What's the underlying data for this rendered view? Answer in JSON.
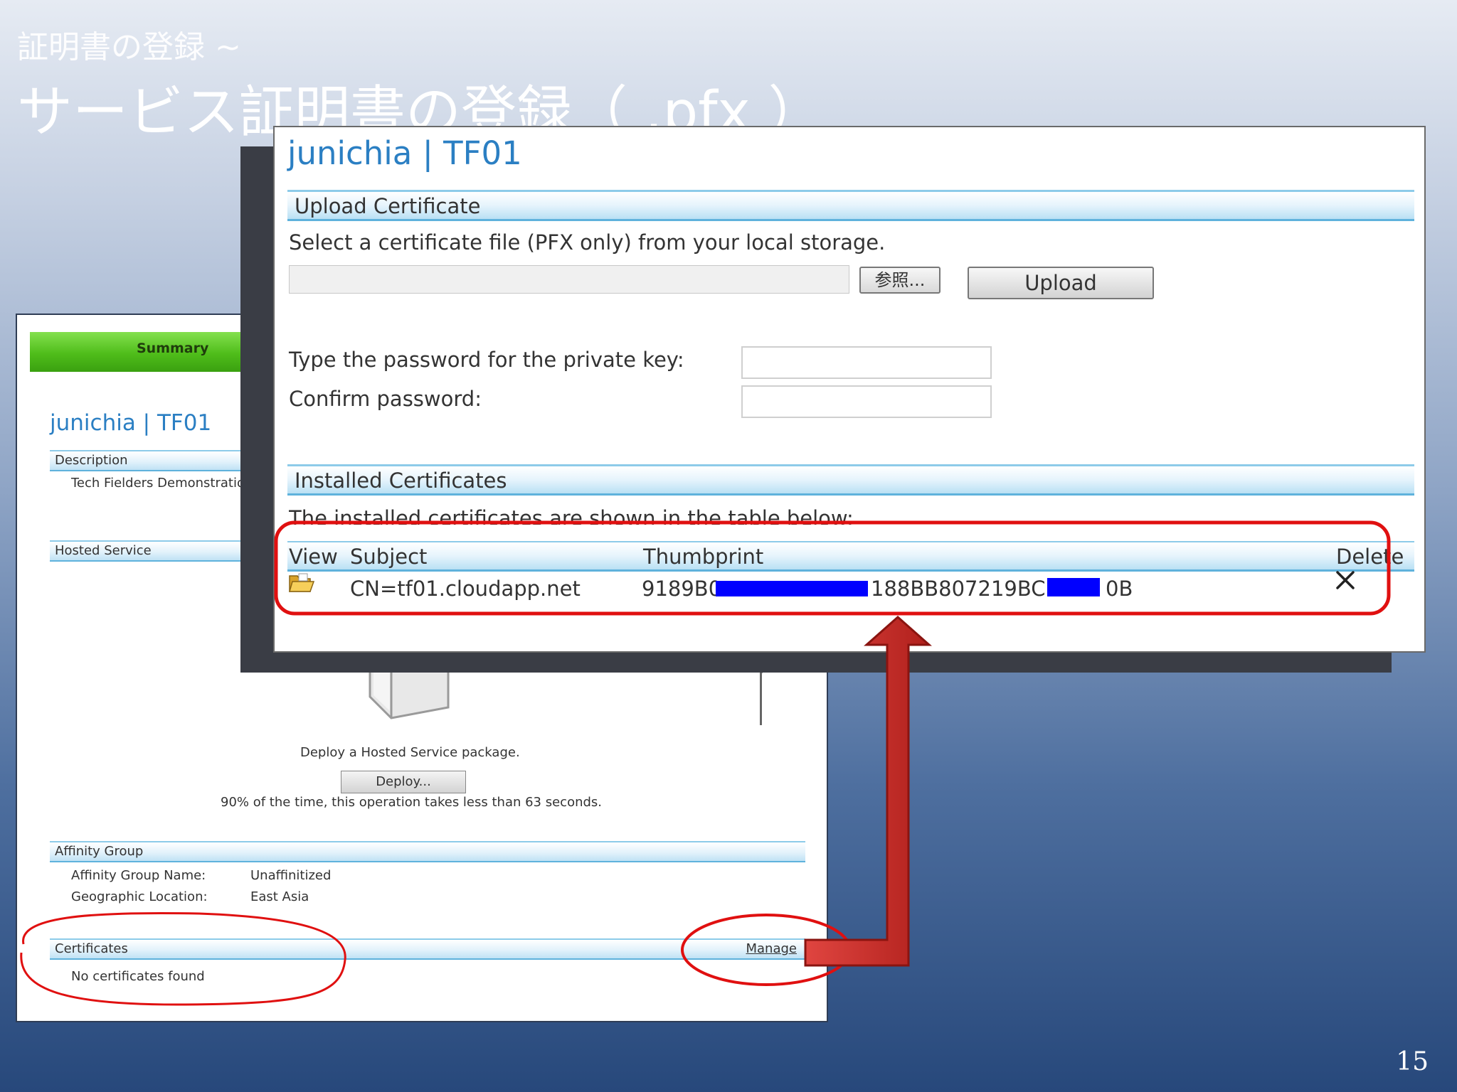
{
  "slide": {
    "subtitle": "証明書の登録 ~",
    "title": "サービス証明書の登録（ .pfx ）",
    "page_number": "15"
  },
  "back_window": {
    "summary_tab": "Summary",
    "title": "junichia | TF01",
    "description": {
      "label": "Description",
      "text": "Tech Fielders Demonstration"
    },
    "hosted_service": {
      "label": "Hosted Service",
      "deploy_text": "Deploy a Hosted Service package.",
      "deploy_button": "Deploy...",
      "deploy_note": "90% of the time, this operation takes less than 63 seconds."
    },
    "affinity_group": {
      "label": "Affinity Group",
      "name_label": "Affinity Group Name:",
      "name_value": "Unaffinitized",
      "location_label": "Geographic Location:",
      "location_value": "East Asia"
    },
    "certificates": {
      "label": "Certificates",
      "manage_link": "Manage",
      "empty_text": "No certificates found"
    }
  },
  "front_window": {
    "title": "junichia | TF01",
    "upload_section": {
      "header": "Upload Certificate",
      "instruction": "Select a certificate file (PFX only) from your local storage.",
      "file_value": "",
      "browse_button": "参照...",
      "upload_button": "Upload",
      "password_label": "Type the password for the private key:",
      "confirm_label": "Confirm password:"
    },
    "installed_section": {
      "header": "Installed Certificates",
      "description": "The installed certificates are shown in the table below:",
      "columns": [
        "View",
        "Subject",
        "Thumbprint",
        "Delete"
      ],
      "rows": [
        {
          "subject": "CN=tf01.cloudapp.net",
          "thumbprint_start": "9189B0",
          "thumbprint_mid": "188BB807219BCD",
          "thumbprint_end": "0B"
        }
      ]
    }
  },
  "colors": {
    "accent_blue": "#2b7fc3",
    "highlight_red": "#e01010",
    "summary_green": "#4fbd1a",
    "redaction_blue": "#0000ff"
  }
}
